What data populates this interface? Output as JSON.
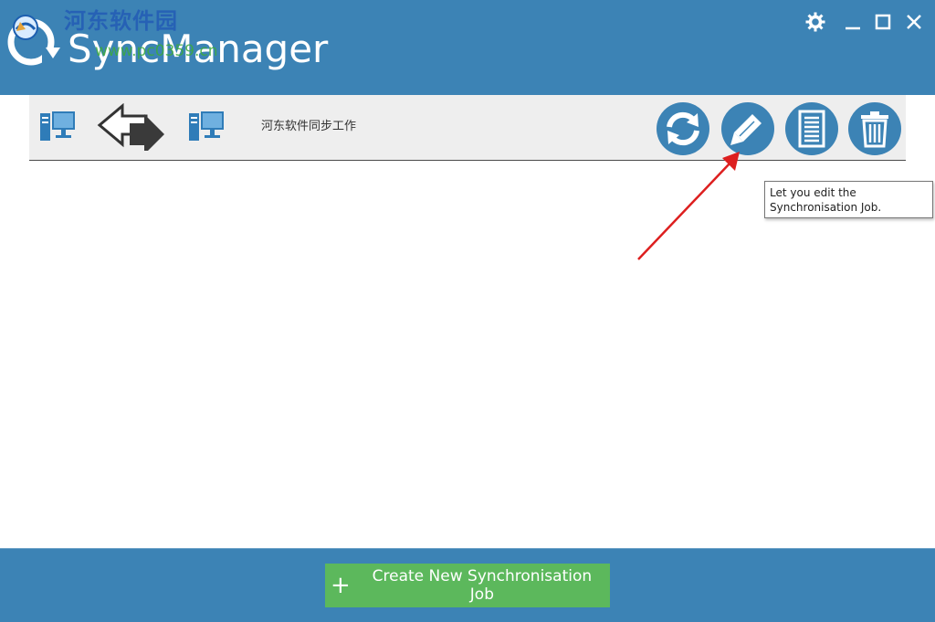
{
  "app": {
    "title": "SyncManager",
    "watermark_site": "河东软件园",
    "watermark_url": "www.pc0359.cn"
  },
  "window_controls": {
    "settings_icon": "gear-icon",
    "minimize_icon": "minimize-icon",
    "maximize_icon": "maximize-icon",
    "close_icon": "close-icon"
  },
  "job": {
    "name": "河东软件同步工作",
    "source_icon": "computer-icon",
    "direction_icon": "bidirectional-arrow-icon",
    "target_icon": "computer-icon",
    "actions": [
      {
        "id": "sync",
        "icon": "sync-icon"
      },
      {
        "id": "edit",
        "icon": "pencil-icon"
      },
      {
        "id": "log",
        "icon": "document-icon"
      },
      {
        "id": "delete",
        "icon": "trash-icon"
      }
    ]
  },
  "tooltip": {
    "line1": "Let you edit the",
    "line2": "Synchronisation Job."
  },
  "footer": {
    "create_label": "Create New Synchronisation Job"
  },
  "colors": {
    "primary": "#3c83b5",
    "row_bg": "#eeeeee",
    "create_button": "#5cb85c",
    "annotation": "#dd1f1f"
  }
}
